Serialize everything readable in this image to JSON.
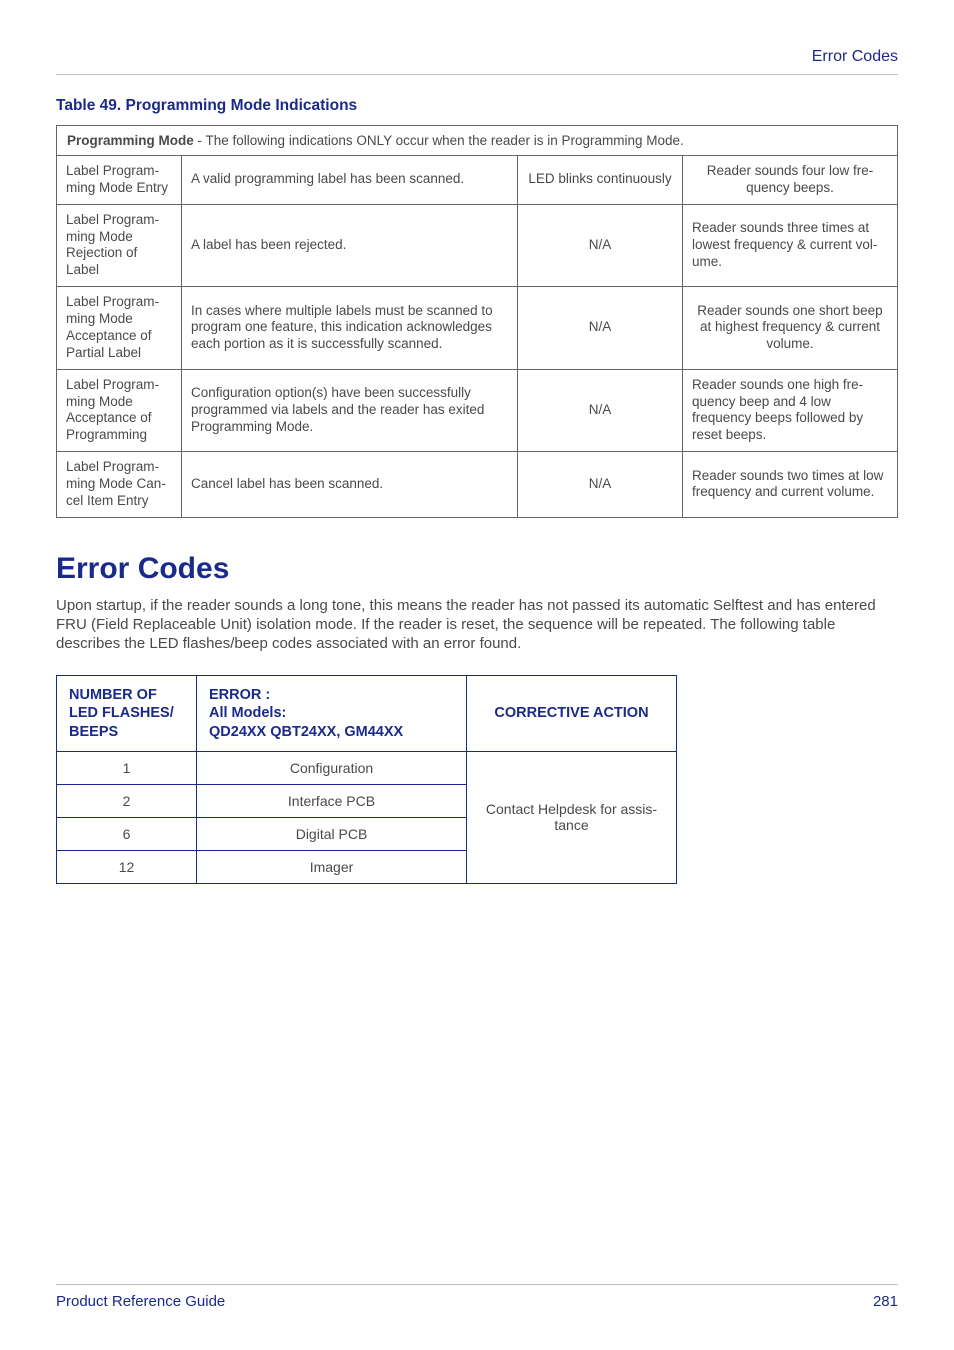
{
  "header": {
    "right": "Error Codes"
  },
  "table49": {
    "caption": "Table 49. Programming Mode Indications",
    "intro_bold": "Programming Mode",
    "intro_rest": " - The following indications ONLY occur when the reader is in Programming Mode.",
    "rows": [
      {
        "c1": "Label Program­ming Mode Entry",
        "c2": "A valid programming label has been scanned.",
        "c3": "LED blinks continuously",
        "c4": "Reader sounds four low fre­quency beeps."
      },
      {
        "c1": "Label Program­ming Mode Rejec­tion of Label",
        "c2": "A label has been rejected.",
        "c3": "N/A",
        "c4": "Reader sounds three times at lowest frequency & current vol­ume."
      },
      {
        "c1": "Label Program­ming Mode Acceptance of Partial Label",
        "c2": "In cases where multiple labels must be scanned to program one feature, this indication acknowl­edges each portion as it is suc­cessfully scanned.",
        "c3": "N/A",
        "c4": "Reader sounds one short beep at highest frequency & current vol­ume."
      },
      {
        "c1": "Label Program­ming Mode Acceptance of Programming",
        "c2": "Configuration option(s) have been successfully programmed via labels and the reader has exited Programming Mode.",
        "c3": "N/A",
        "c4": "Reader sounds one high fre­quency beep and 4 low frequency beeps followed by reset beeps."
      },
      {
        "c1": "Label Program­ming Mode Can­cel Item Entry",
        "c2": "Cancel label has been scanned.",
        "c3": "N/A",
        "c4": "Reader sounds two times at low frequency and current volume."
      }
    ]
  },
  "error_section": {
    "heading": "Error Codes",
    "body": "Upon startup, if the reader sounds a long tone, this means the reader has not passed its auto­matic Selftest and has entered FRU (Field Replaceable Unit) isolation mode. If the reader is reset, the sequence will be repeated. The following table describes the LED flashes/beep codes asso­ciated with an error found."
  },
  "err_table": {
    "head": {
      "c1a": "NUMBER OF",
      "c1b": "LED FLASHES/",
      "c1c": "BEEPS",
      "c2a": "ERROR :",
      "c2b": "All Models:",
      "c2c": "QD24XX QBT24XX, GM44XX",
      "c3": "CORRECTIVE ACTION"
    },
    "rows": [
      {
        "num": "1",
        "err": "Configuration"
      },
      {
        "num": "2",
        "err": "Interface PCB"
      },
      {
        "num": "6",
        "err": "Digital PCB"
      },
      {
        "num": "12",
        "err": "Imager"
      }
    ],
    "action": "Contact Helpdesk for assis­tance"
  },
  "footer": {
    "left": "Product Reference Guide",
    "right": "281"
  }
}
